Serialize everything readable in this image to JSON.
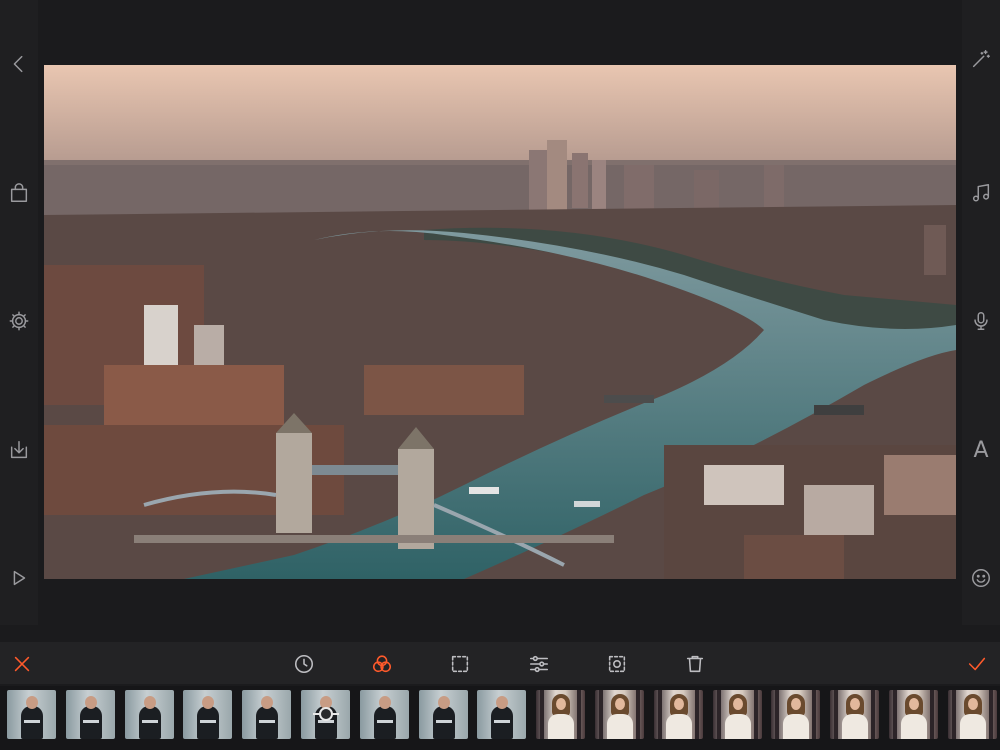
{
  "left_rail": [
    {
      "name": "back-icon"
    },
    {
      "name": "shopping-bag-icon"
    },
    {
      "name": "gear-icon"
    },
    {
      "name": "download-icon"
    },
    {
      "name": "play-icon"
    }
  ],
  "right_rail": [
    {
      "name": "magic-wand-icon"
    },
    {
      "name": "music-note-icon"
    },
    {
      "name": "microphone-icon"
    },
    {
      "name": "text-tool",
      "glyph": "A"
    },
    {
      "name": "emoji-icon"
    }
  ],
  "toolbar": {
    "cancel": "close-icon",
    "confirm": "checkmark-icon",
    "tools": [
      {
        "name": "speed-icon"
      },
      {
        "name": "filters-icon",
        "active": true
      },
      {
        "name": "crop-icon"
      },
      {
        "name": "adjust-icon"
      },
      {
        "name": "focus-icon"
      },
      {
        "name": "trash-icon"
      }
    ]
  },
  "filmstrip": {
    "thumbnails": 17,
    "selected_index": 5
  },
  "colors": {
    "accent": "#ff5a2b",
    "background": "#1b1b1d",
    "icon": "#9a9a9e"
  }
}
